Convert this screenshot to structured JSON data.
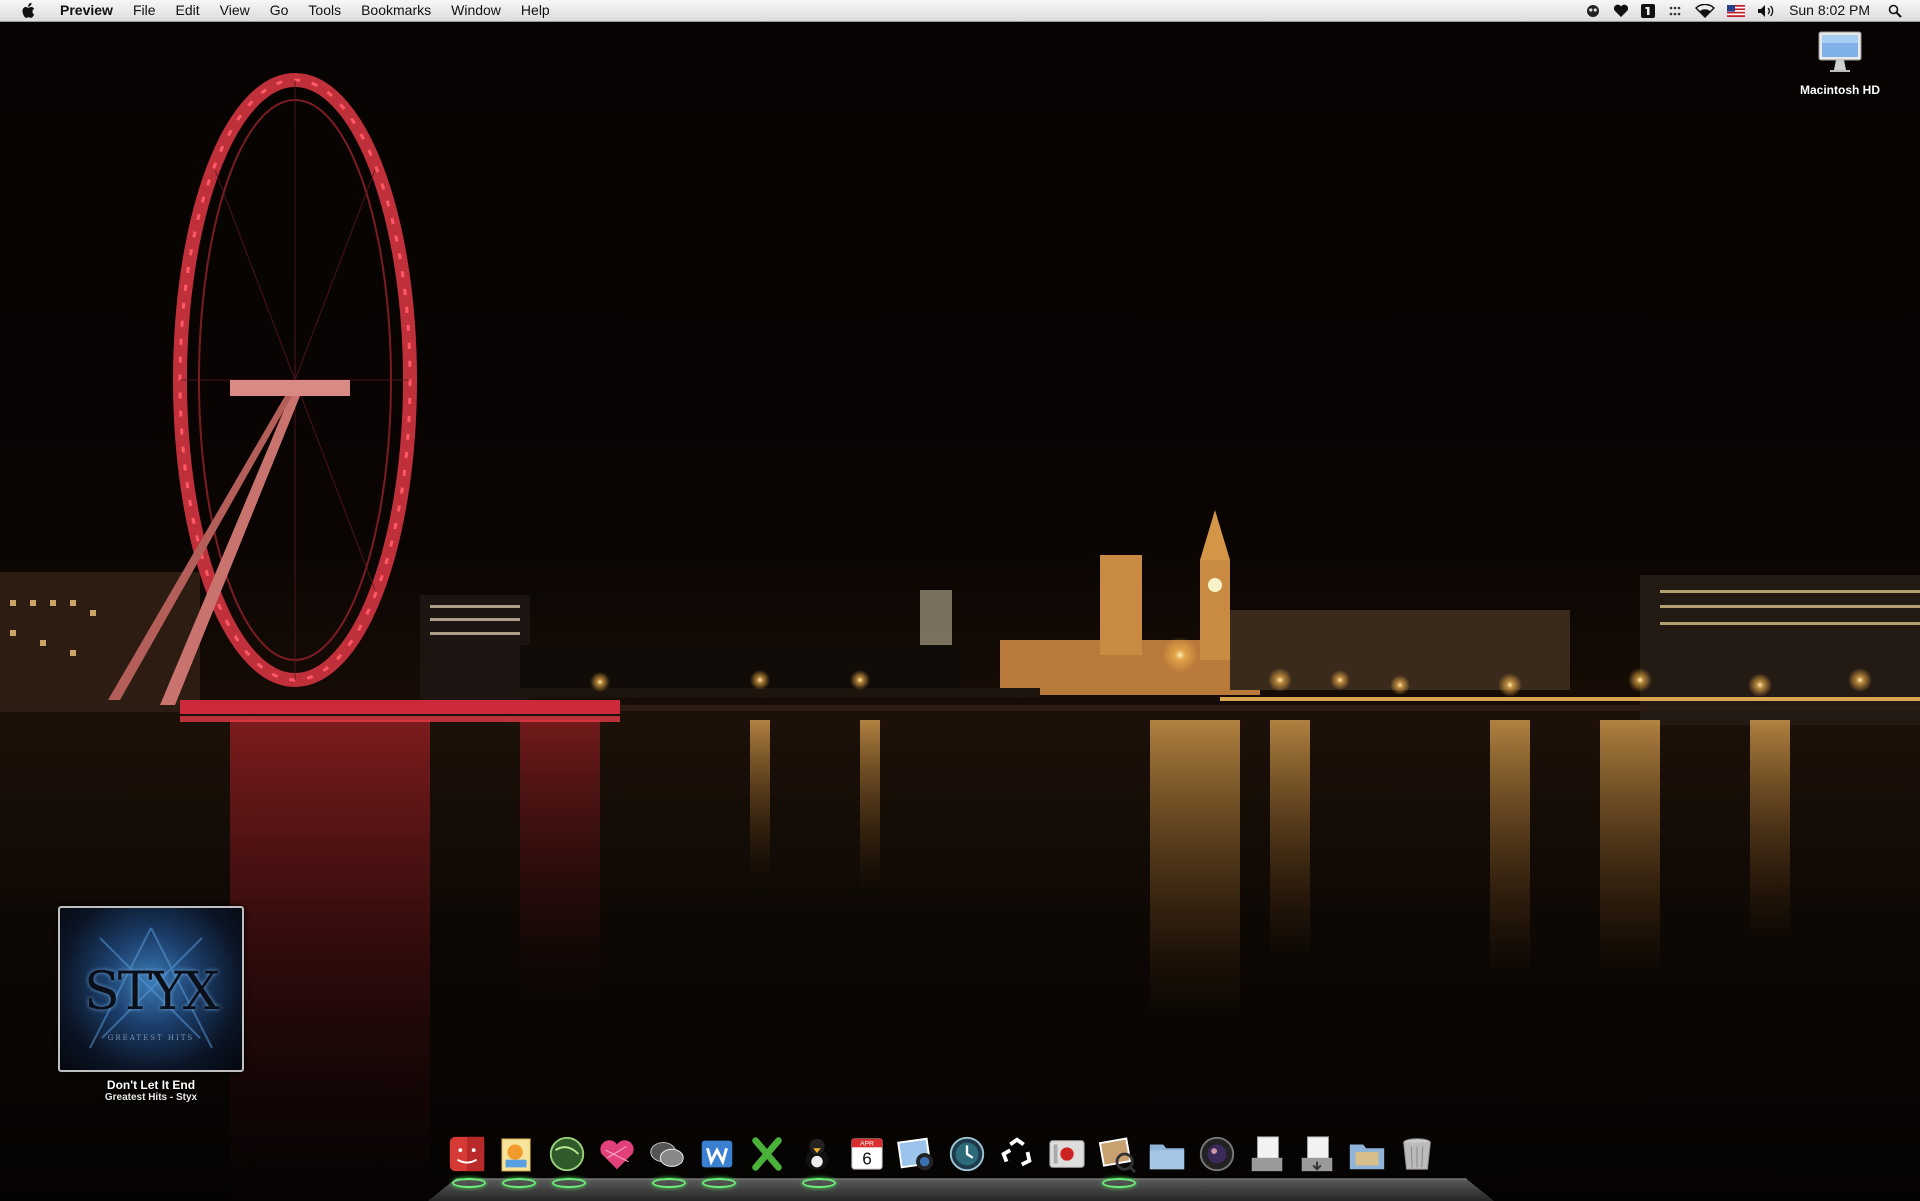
{
  "menubar": {
    "app_name": "Preview",
    "menus": [
      "File",
      "Edit",
      "View",
      "Go",
      "Tools",
      "Bookmarks",
      "Window",
      "Help"
    ],
    "status_icons": [
      "alien-icon",
      "heart-icon",
      "one-password-icon",
      "spaces-icon",
      "wifi-icon",
      "us-flag-icon",
      "volume-icon"
    ],
    "clock": "Sun 8:02 PM"
  },
  "desktop": {
    "drive_label": "Macintosh HD"
  },
  "now_playing": {
    "song": "Don't Let It End",
    "album_artist": "Greatest Hits - Styx",
    "cover_text": "STYX",
    "cover_subtext": "GREATEST HITS"
  },
  "dock": {
    "items": [
      {
        "icon": "finder-icon",
        "running": true
      },
      {
        "icon": "preview-icon",
        "running": true
      },
      {
        "icon": "globe-icon",
        "running": true
      },
      {
        "icon": "heart-app-icon",
        "running": false
      },
      {
        "icon": "colloquy-icon",
        "running": true
      },
      {
        "icon": "word-icon",
        "running": true
      },
      {
        "icon": "excel-icon",
        "running": false
      },
      {
        "icon": "adium-duck-icon",
        "running": true
      },
      {
        "icon": "ical-icon",
        "running": false
      },
      {
        "icon": "iphoto-icon",
        "running": false
      },
      {
        "icon": "time-machine-icon",
        "running": false
      },
      {
        "icon": "recycle-icon",
        "running": false
      },
      {
        "icon": "system-preferences-icon",
        "running": false
      },
      {
        "icon": "preview-photos-icon",
        "running": true
      },
      {
        "icon": "applications-folder-icon",
        "running": false
      },
      {
        "icon": "camera-lens-icon",
        "running": false
      },
      {
        "icon": "documents-stack-icon",
        "running": false
      },
      {
        "icon": "downloads-stack-icon",
        "running": false
      },
      {
        "icon": "pictures-folder-icon",
        "running": false
      },
      {
        "icon": "trash-icon",
        "running": false
      }
    ],
    "ical_day": "6",
    "ical_month": "APR"
  },
  "colors": {
    "menubar_top": "#f7f7f7",
    "menubar_bottom": "#dcdcdc",
    "eye_red": "#e2313d",
    "river_gold": "#d9a14a",
    "sky": "#050302",
    "running_indicator": "#6df07a"
  }
}
